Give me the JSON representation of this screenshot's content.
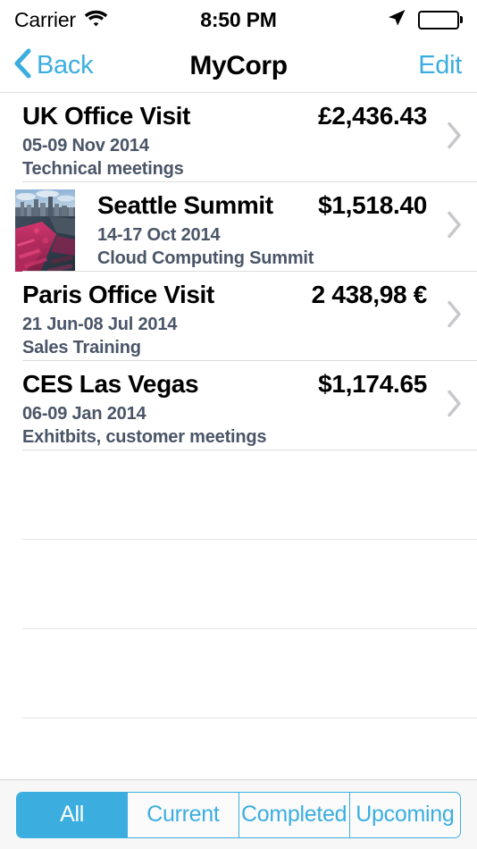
{
  "status_bar": {
    "carrier": "Carrier",
    "wifi_icon": "wifi-icon",
    "time": "8:50 PM",
    "location_icon": "location-arrow-icon",
    "battery_icon": "battery-full-icon"
  },
  "nav_bar": {
    "back_icon": "chevron-left-icon",
    "back_label": "Back",
    "title": "MyCorp",
    "edit_label": "Edit",
    "tint_color": "#3BAEDF"
  },
  "trips": [
    {
      "title": "UK Office Visit",
      "amount": "£2,436.43",
      "dates": "05-09 Nov 2014",
      "description": "Technical meetings",
      "has_thumbnail": false,
      "disclosure_icon": "chevron-right-icon"
    },
    {
      "title": "Seattle Summit",
      "amount": "$1,518.40",
      "dates": "14-17 Oct 2014",
      "description": "Cloud Computing Summit",
      "has_thumbnail": true,
      "thumbnail_name": "seattle-aerial-photo",
      "disclosure_icon": "chevron-right-icon"
    },
    {
      "title": "Paris Office Visit",
      "amount": "2 438,98 €",
      "dates": "21 Jun-08 Jul 2014",
      "description": "Sales Training",
      "has_thumbnail": false,
      "disclosure_icon": "chevron-right-icon"
    },
    {
      "title": "CES Las Vegas",
      "amount": "$1,174.65",
      "dates": "06-09 Jan 2014",
      "description": "Exhitbits, customer meetings",
      "has_thumbnail": false,
      "disclosure_icon": "chevron-right-icon"
    }
  ],
  "empty_row_count": 4,
  "segmented_control": {
    "selected_index": 0,
    "options": [
      {
        "label": "All"
      },
      {
        "label": "Current"
      },
      {
        "label": "Completed"
      },
      {
        "label": "Upcoming"
      }
    ],
    "tint_color": "#3BAEDF",
    "selected_text_color": "#FFFFFF"
  },
  "colors": {
    "accent": "#3BAEDF",
    "title_text": "#000000",
    "subtitle_text": "#4A5568",
    "separator": "#DCDCDC",
    "toolbar_bg": "#F7F7F7"
  }
}
